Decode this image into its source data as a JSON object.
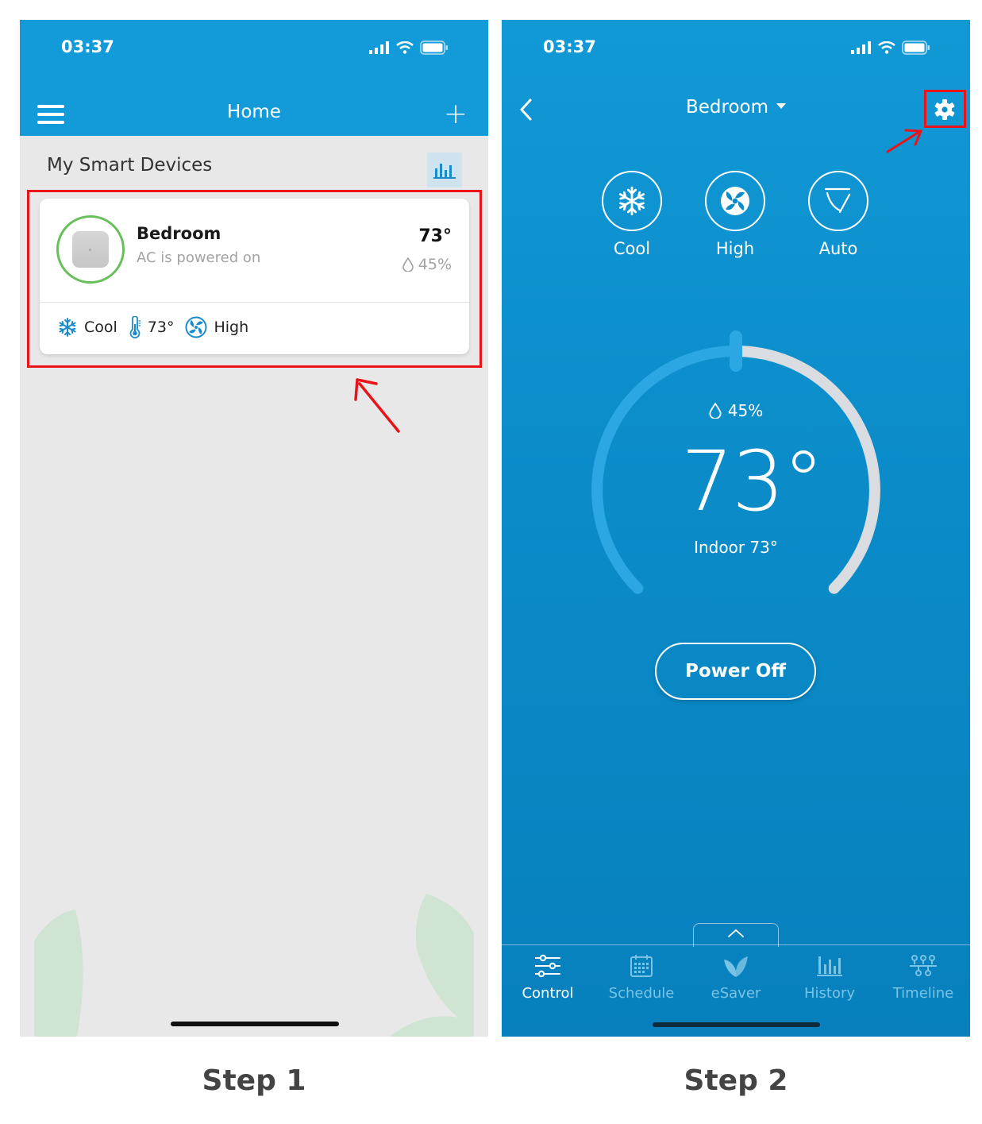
{
  "status_bar": {
    "time": "03:37"
  },
  "step1": {
    "header": {
      "title": "Home"
    },
    "section_title": "My Smart Devices",
    "device": {
      "name": "Bedroom",
      "status": "AC is powered on",
      "temperature": "73°",
      "humidity": "45%",
      "footer": {
        "mode": "Cool",
        "set_temp": "73°",
        "fan": "High"
      }
    },
    "caption": "Step 1"
  },
  "step2": {
    "room": "Bedroom",
    "modes": [
      {
        "label": "Cool",
        "icon": "snowflake-icon"
      },
      {
        "label": "High",
        "icon": "fan-icon"
      },
      {
        "label": "Auto",
        "icon": "auto-swing-icon"
      }
    ],
    "dial": {
      "humidity": "45%",
      "set_temp": "73°",
      "indoor": "Indoor 73°",
      "level": 0.5
    },
    "power_button": "Power Off",
    "tabs": [
      {
        "label": "Control",
        "icon": "control-sliders-icon",
        "active": true
      },
      {
        "label": "Schedule",
        "icon": "calendar-icon",
        "active": false
      },
      {
        "label": "eSaver",
        "icon": "leaf-icon",
        "active": false
      },
      {
        "label": "History",
        "icon": "bar-chart-icon",
        "active": false
      },
      {
        "label": "Timeline",
        "icon": "timeline-icon",
        "active": false
      }
    ],
    "caption": "Step 2"
  },
  "colors": {
    "header_blue": "#139ad8",
    "control_blue": "#0b8cc9",
    "highlight_red": "#e8141a",
    "power_ring_green": "#68c05a"
  }
}
